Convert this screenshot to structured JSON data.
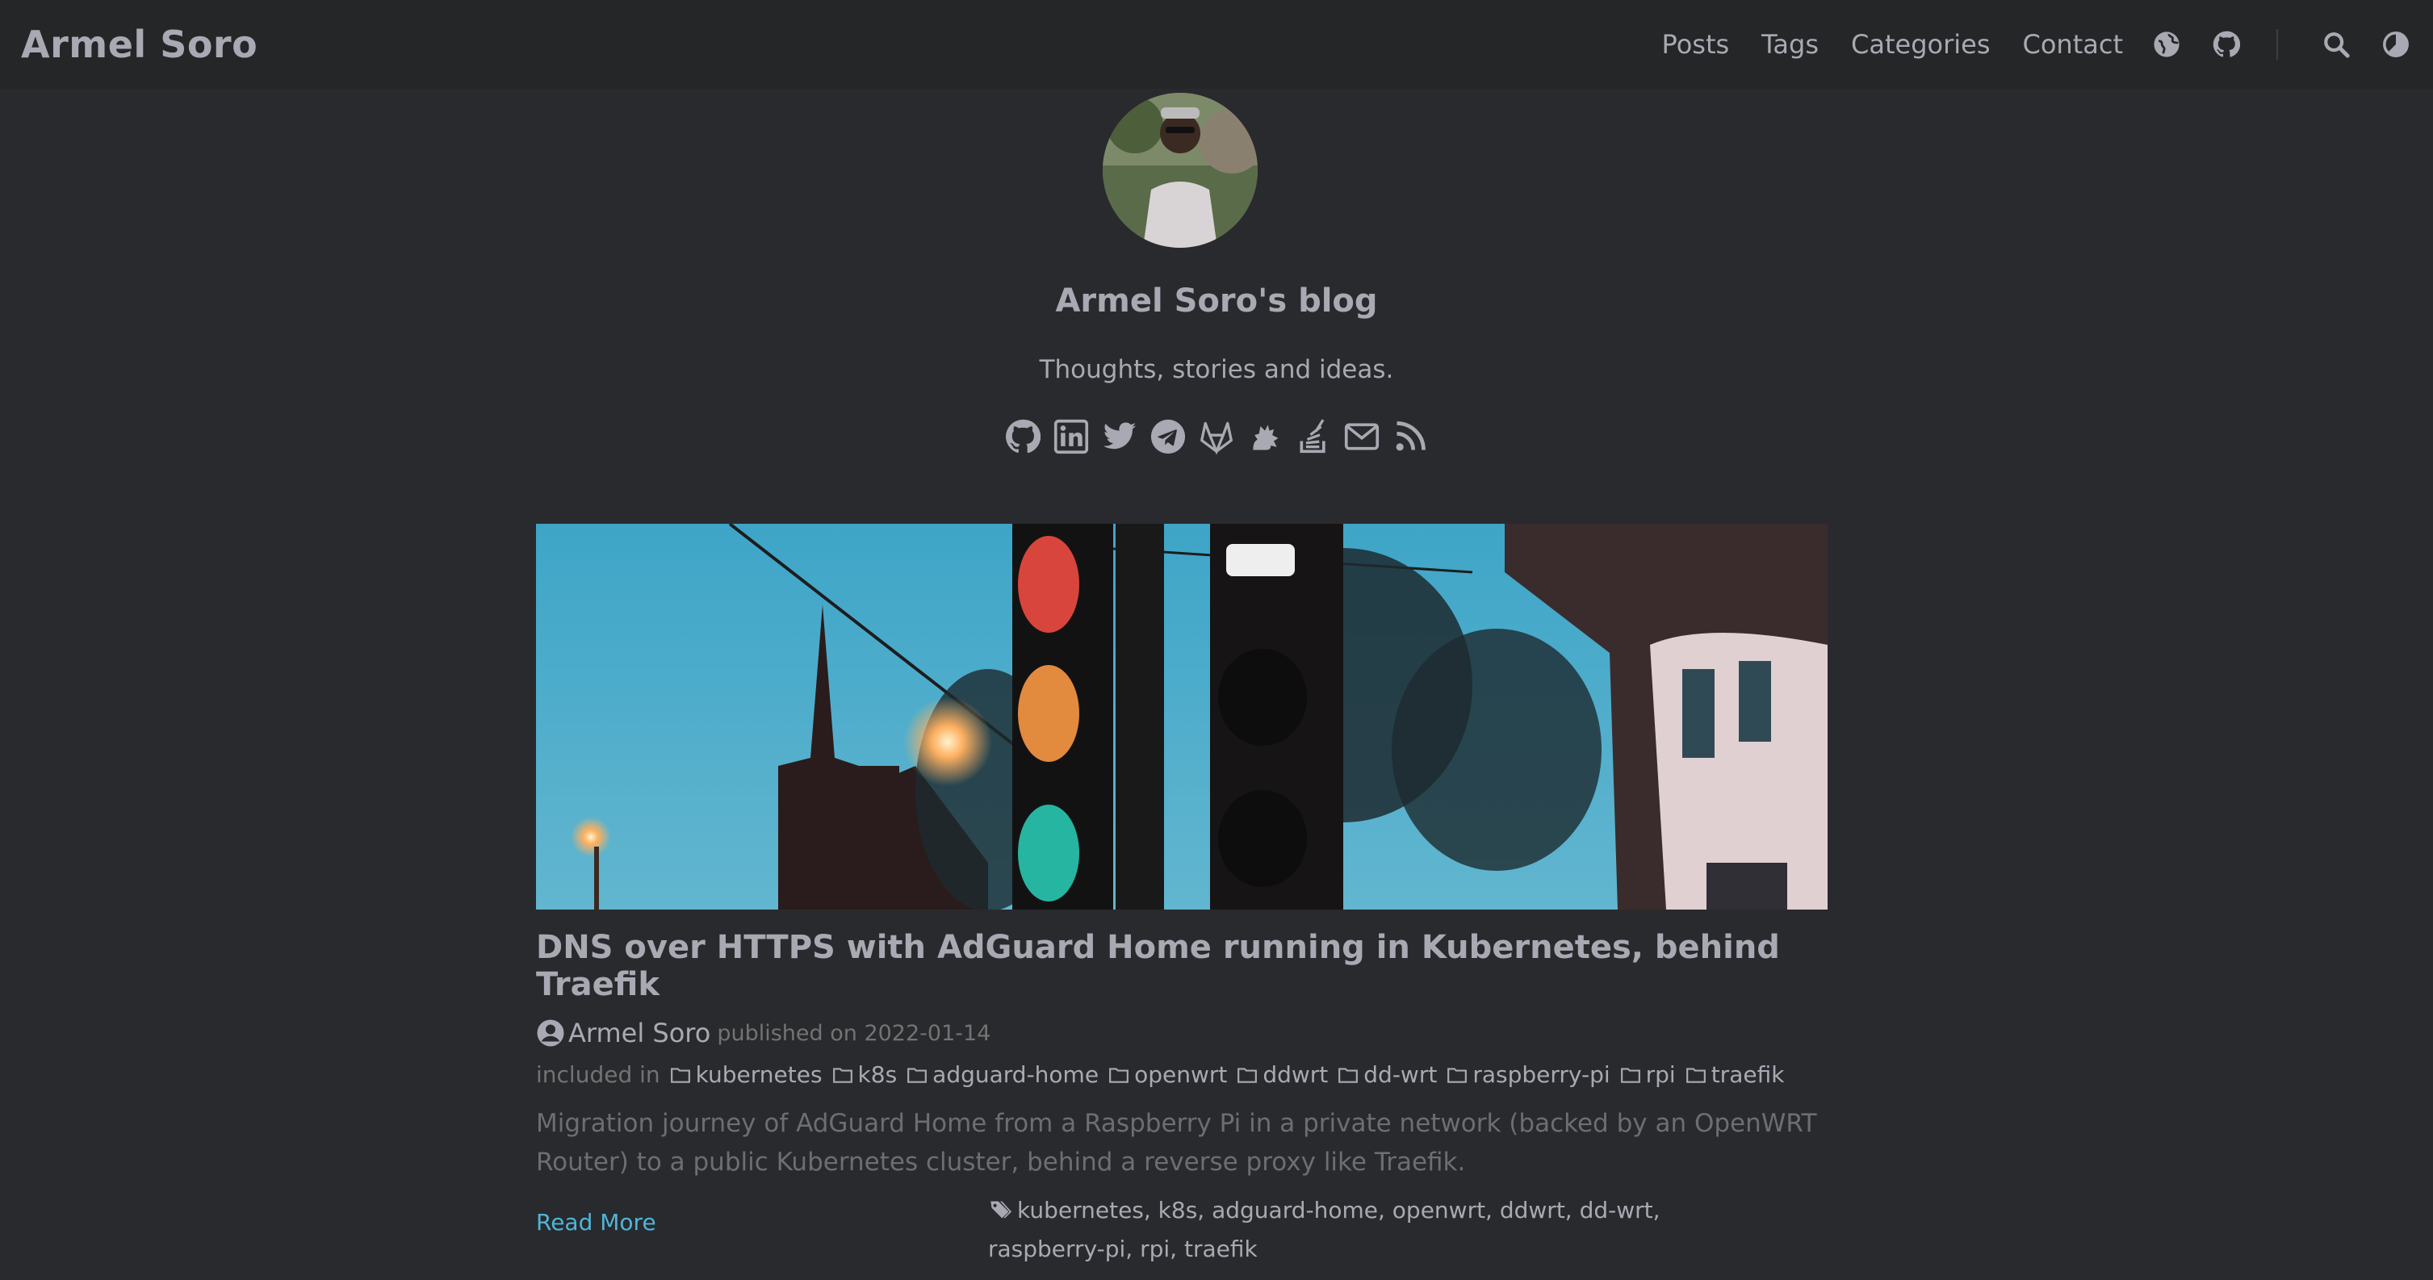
{
  "header": {
    "brand": "Armel Soro",
    "menu": [
      "Posts",
      "Tags",
      "Categories",
      "Contact"
    ],
    "icons": [
      "language-icon",
      "github-icon",
      "search-icon",
      "theme-toggle-icon"
    ]
  },
  "profile": {
    "title": "Armel Soro's blog",
    "subtitle": "Thoughts, stories and ideas.",
    "social_icons": [
      "github-icon",
      "linkedin-icon",
      "twitter-icon",
      "telegram-icon",
      "gitlab-icon",
      "mastodon-icon",
      "stackoverflow-icon",
      "email-icon",
      "rss-icon"
    ]
  },
  "post": {
    "title": "DNS over HTTPS with AdGuard Home running in Kubernetes, behind Traefik",
    "author": "Armel Soro",
    "published": "published on 2022-01-14",
    "included_in": "included in",
    "categories": [
      "kubernetes",
      "k8s",
      "adguard-home",
      "openwrt",
      "ddwrt",
      "dd-wrt",
      "raspberry-pi",
      "rpi",
      "traefik"
    ],
    "summary": "Migration journey of AdGuard Home from a Raspberry Pi in a private network (backed by an OpenWRT Router) to a public Kubernetes cluster, behind a reverse proxy like Traefik.",
    "read_more": "Read More",
    "tags": "kubernetes, k8s, adguard-home, openwrt, ddwrt, dd-wrt, raspberry-pi, rpi, traefik"
  },
  "colors": {
    "background": "#292a2d",
    "header": "#252627",
    "text": "#a9a9b3",
    "link": "#4eb5d8"
  }
}
